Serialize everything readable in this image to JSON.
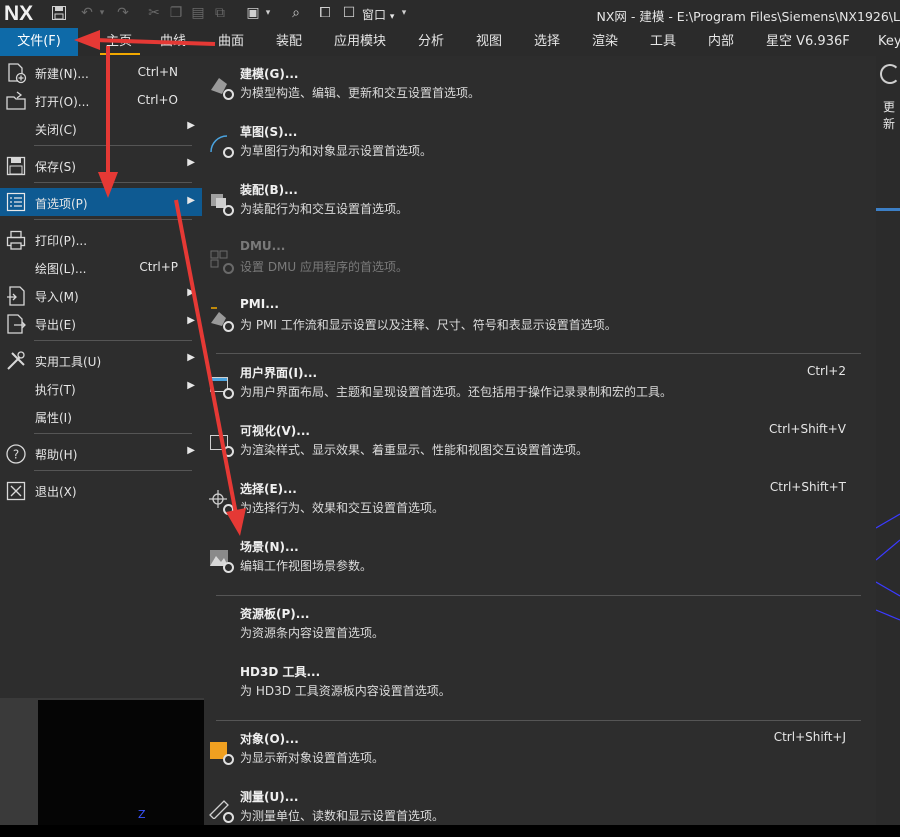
{
  "app": {
    "logo": "NX",
    "window_menu": "窗口",
    "title": "NX网 - 建模 - E:\\Program Files\\Siemens\\NX1926\\L"
  },
  "ribbon": {
    "file_tab": "文件(F)",
    "tabs": [
      "主页",
      "曲线",
      "曲面",
      "装配",
      "应用模块",
      "分析",
      "视图",
      "选择",
      "渲染",
      "工具",
      "内部",
      "星空 V6.936F",
      "Key"
    ]
  },
  "right_panel": {
    "label": "更新"
  },
  "canvas": {
    "axis_label": "Z"
  },
  "file_menu": {
    "items": [
      {
        "label": "新建(N)...",
        "shortcut": "Ctrl+N",
        "icon": "new-file-icon"
      },
      {
        "label": "打开(O)...",
        "shortcut": "Ctrl+O",
        "icon": "open-folder-icon"
      },
      {
        "label": "关闭(C)",
        "submenu": true
      },
      {
        "label": "保存(S)",
        "submenu": true,
        "icon": "save-icon"
      },
      {
        "label": "首选项(P)",
        "submenu": true,
        "selected": true,
        "icon": "preferences-list-icon"
      },
      {
        "label": "打印(P)...",
        "icon": "printer-icon"
      },
      {
        "label": "绘图(L)...",
        "shortcut": "Ctrl+P"
      },
      {
        "label": "导入(M)",
        "submenu": true,
        "icon": "import-icon"
      },
      {
        "label": "导出(E)",
        "submenu": true,
        "icon": "export-icon"
      },
      {
        "label": "实用工具(U)",
        "submenu": true,
        "icon": "utilities-icon"
      },
      {
        "label": "执行(T)",
        "submenu": true
      },
      {
        "label": "属性(I)"
      },
      {
        "label": "帮助(H)",
        "submenu": true,
        "icon": "help-icon"
      },
      {
        "label": "退出(X)",
        "icon": "exit-icon"
      }
    ]
  },
  "preferences_menu": {
    "items": [
      {
        "title": "建模(G)...",
        "desc": "为模型构造、编辑、更新和交互设置首选项。",
        "icon": "modeling-gear-icon"
      },
      {
        "title": "草图(S)...",
        "desc": "为草图行为和对象显示设置首选项。",
        "icon": "sketch-gear-icon"
      },
      {
        "title": "装配(B)...",
        "desc": "为装配行为和交互设置首选项。",
        "icon": "assembly-gear-icon"
      },
      {
        "title": "DMU...",
        "desc": "设置 DMU 应用程序的首选项。",
        "disabled": true,
        "icon": "dmu-gear-icon"
      },
      {
        "title": "PMI...",
        "desc": "为 PMI 工作流和显示设置以及注释、尺寸、符号和表显示设置首选项。",
        "icon": "pmi-gear-icon"
      },
      {
        "title": "用户界面(I)...",
        "desc": "为用户界面布局、主题和呈现设置首选项。还包括用于操作记录录制和宏的工具。",
        "shortcut": "Ctrl+2",
        "icon": "user-interface-gear-icon"
      },
      {
        "title": "可视化(V)...",
        "desc": "为渲染样式、显示效果、着重显示、性能和视图交互设置首选项。",
        "shortcut": "Ctrl+Shift+V",
        "icon": "visualization-gear-icon"
      },
      {
        "title": "选择(E)...",
        "desc": "为选择行为、效果和交互设置首选项。",
        "shortcut": "Ctrl+Shift+T",
        "icon": "selection-gear-icon"
      },
      {
        "title": "场景(N)...",
        "desc": "编辑工作视图场景参数。",
        "icon": "scene-gear-icon"
      },
      {
        "title": "资源板(P)...",
        "desc": "为资源条内容设置首选项。"
      },
      {
        "title": "HD3D 工具...",
        "desc": "为 HD3D 工具资源板内容设置首选项。"
      },
      {
        "title": "对象(O)...",
        "desc": "为显示新对象设置首选项。",
        "shortcut": "Ctrl+Shift+J",
        "icon": "object-gear-icon"
      },
      {
        "title": "测量(U)...",
        "desc": "为测量单位、读数和显示设置首选项。",
        "icon": "measure-gear-icon"
      }
    ]
  },
  "colors": {
    "accent": "#0e6aa8",
    "selected": "#0e5a92",
    "annotation_arrow": "#e53935",
    "menu_bg": "#2d2d2d"
  }
}
